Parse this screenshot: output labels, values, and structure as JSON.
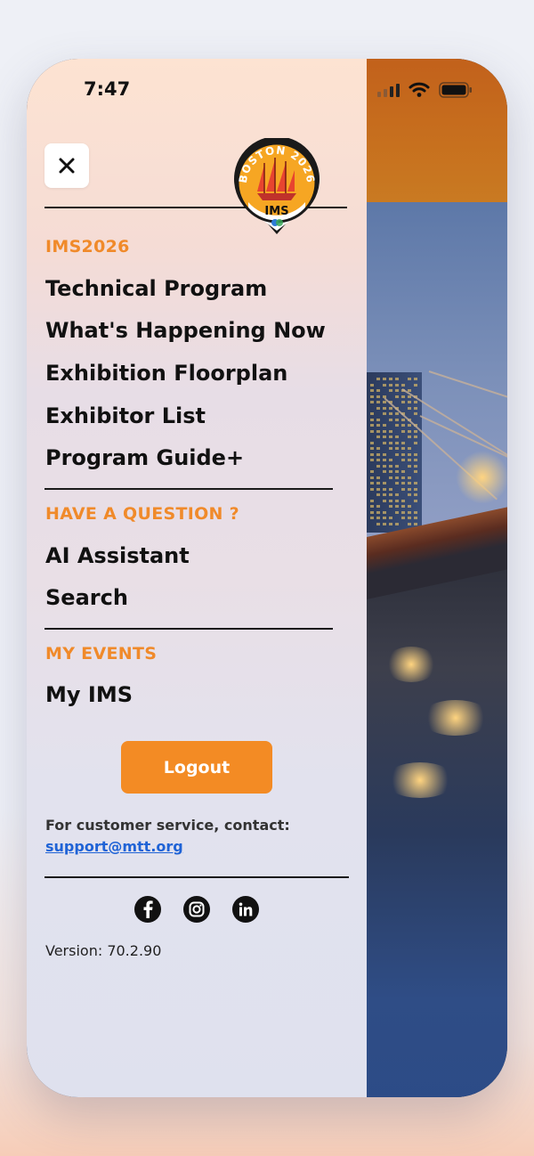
{
  "status_bar": {
    "time": "7:47"
  },
  "menu": {
    "sections": [
      {
        "heading": "IMS2026",
        "items": [
          "Technical Program",
          "What's Happening Now",
          "Exhibition Floorplan",
          "Exhibitor List",
          "Program Guide+"
        ]
      },
      {
        "heading": "HAVE A QUESTION ?",
        "items": [
          "AI Assistant",
          "Search"
        ]
      },
      {
        "heading": "MY EVENTS",
        "items": [
          "My IMS"
        ]
      }
    ]
  },
  "logo": {
    "arc_text": "BOSTON 2026",
    "mark_text": "IMS"
  },
  "logout_label": "Logout",
  "customer_service": {
    "text": "For customer service, contact:",
    "email": "support@mtt.org"
  },
  "social": [
    "facebook-icon",
    "instagram-icon",
    "linkedin-icon"
  ],
  "version": "Version: 70.2.90",
  "colors": {
    "accent": "#f38b24",
    "section_heading": "#f08a2a",
    "link": "#1f63d6"
  }
}
